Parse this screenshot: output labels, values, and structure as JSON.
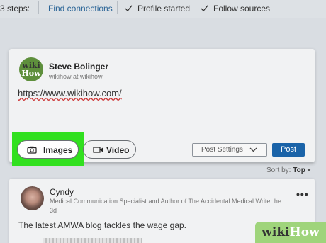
{
  "steps_bar": {
    "prefix": "3 steps:",
    "link": "Find connections",
    "steps": [
      "Profile started",
      "Follow sources"
    ]
  },
  "compose": {
    "avatar_text": [
      "wiki",
      "How"
    ],
    "author_name": "Steve Bolinger",
    "author_sub": "wikihow at wikihow",
    "url": "https://www.wikihow.com/",
    "images_label": "Images",
    "video_label": "Video",
    "post_settings_label": "Post Settings",
    "post_label": "Post",
    "highlight_color": "#31e01f",
    "post_button_color": "#1a63a8"
  },
  "sort": {
    "label": "Sort by:",
    "value": "Top"
  },
  "feed_post": {
    "name": "Cyndy",
    "title": "Medical Communication Specialist and Author of The Accidental Medical Writer he",
    "time": "3d",
    "text": "The latest AMWA blog tackles the wage gap.",
    "more": "•••"
  },
  "watermark": {
    "part1": "wiki",
    "part2": "How"
  }
}
